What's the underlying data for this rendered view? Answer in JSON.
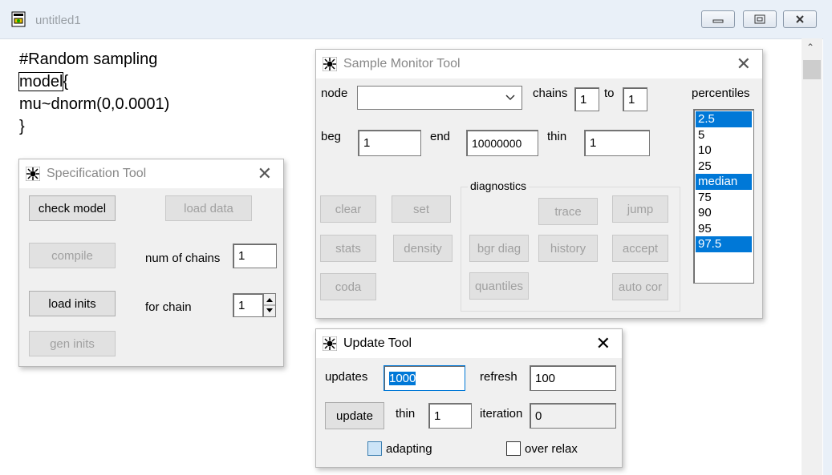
{
  "window": {
    "title": "untitled1",
    "min_label": "▭",
    "max_label": "▣",
    "close_label": "✕"
  },
  "document": {
    "line1": "#Random sampling",
    "line2_word": "model",
    "line2_rest": "{",
    "line3": "mu~dnorm(0,0.0001)",
    "line4": "}"
  },
  "specification_tool": {
    "title": "Specification Tool",
    "check_model": "check model",
    "load_data": "load data",
    "compile": "compile",
    "num_of_chains_label": "num of chains",
    "num_of_chains_value": "1",
    "load_inits": "load inits",
    "for_chain_label": "for chain",
    "for_chain_value": "1",
    "gen_inits": "gen inits"
  },
  "sample_monitor_tool": {
    "title": "Sample Monitor Tool",
    "node_label": "node",
    "node_value": "",
    "chains_label": "chains",
    "chains_from": "1",
    "to_label": "to",
    "chains_to": "1",
    "beg_label": "beg",
    "beg_value": "1",
    "end_label": "end",
    "end_value": "10000000",
    "thin_label": "thin",
    "thin_value": "1",
    "percentiles_label": "percentiles",
    "percentiles": [
      {
        "label": "2.5",
        "selected": true
      },
      {
        "label": "5",
        "selected": false
      },
      {
        "label": "10",
        "selected": false
      },
      {
        "label": "25",
        "selected": false
      },
      {
        "label": "median",
        "selected": true
      },
      {
        "label": "75",
        "selected": false
      },
      {
        "label": "90",
        "selected": false
      },
      {
        "label": "95",
        "selected": false
      },
      {
        "label": "97.5",
        "selected": true
      }
    ],
    "diagnostics_label": "diagnostics",
    "buttons": {
      "clear": "clear",
      "set": "set",
      "trace": "trace",
      "jump": "jump",
      "stats": "stats",
      "density": "density",
      "bgr_diag": "bgr diag",
      "history": "history",
      "accept": "accept",
      "coda": "coda",
      "quantiles": "quantiles",
      "auto_cor": "auto cor"
    }
  },
  "update_tool": {
    "title": "Update Tool",
    "updates_label": "updates",
    "updates_value": "1000",
    "refresh_label": "refresh",
    "refresh_value": "100",
    "update_button": "update",
    "thin_label": "thin",
    "thin_value": "1",
    "iteration_label": "iteration",
    "iteration_value": "0",
    "adapting_label": "adapting",
    "over_relax_label": "over relax"
  },
  "colors": {
    "selection": "#0078d7",
    "titlebar": "#e9f0f8",
    "dialog_bg": "#f0f0f0"
  }
}
